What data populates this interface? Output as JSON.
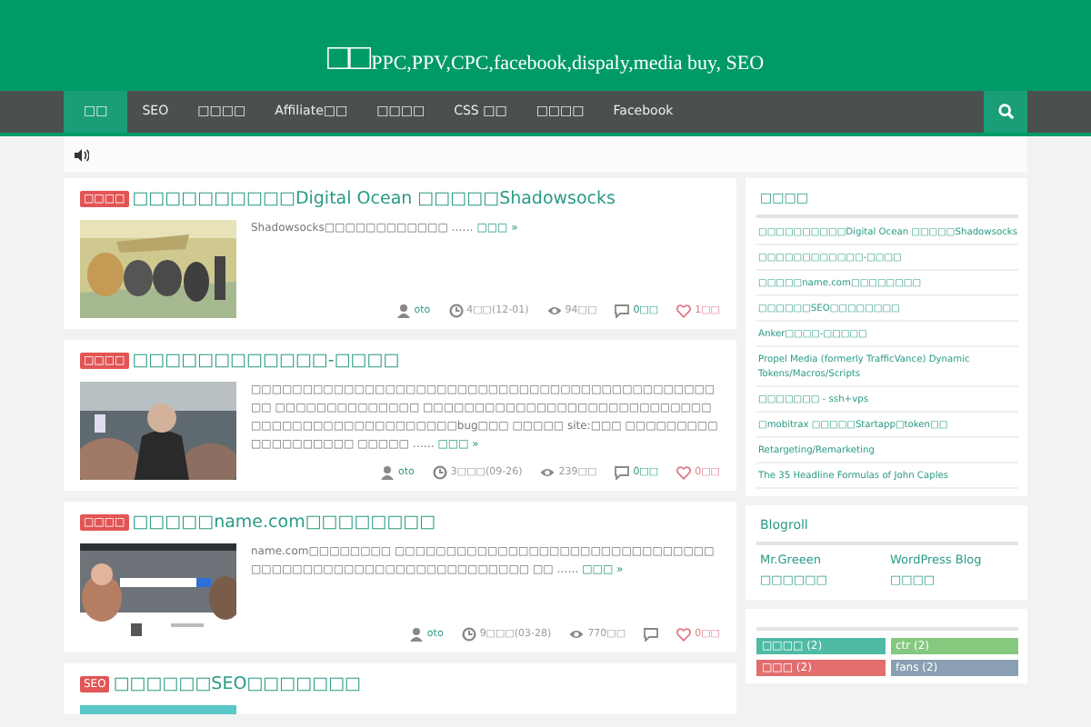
{
  "site": {
    "name": "□□",
    "tagline": "PPC,PPV,CPC,facebook,dispaly,media buy, SEO"
  },
  "nav": [
    {
      "label": "□□",
      "selected": true
    },
    {
      "label": "SEO",
      "selected": false
    },
    {
      "label": "□□□□",
      "selected": false
    },
    {
      "label": "Affiliate□□",
      "selected": false
    },
    {
      "label": "□□□□",
      "selected": false
    },
    {
      "label": "CSS □□",
      "selected": false
    },
    {
      "label": "□□□□",
      "selected": false
    },
    {
      "label": "Facebook",
      "selected": false
    }
  ],
  "posts": [
    {
      "tag": "□□□□",
      "title": "□□□□□□□□□□Digital Ocean □□□□□Shadowsocks",
      "kind": "picture",
      "excerpt": "Shadowsocks□□□□□□□□□□□□ ……",
      "more": "□□□ »",
      "author": "oto",
      "date": "4□□(12-01)",
      "views": "94□□",
      "comments": "0□□",
      "likes": "1□□"
    },
    {
      "tag": "□□□□",
      "title": "□□□□□□□□□□□□-□□□□",
      "kind": "picture",
      "excerpt": "□□□□□□□□□□□□□□□□□□□□□□□□□□□□□□□□□□□□□□□□□□□□□□□ □□□□□□□□□□□□□□ □□□□□□□□□□□□□□□□□□□□□□□□□□□□□□□□□□□□□□□□□□□□□□□□bug□□□ □□□□□ site:□□□ □□□□□□□□□□□□□□□□□□□ □□□□□ ……",
      "more": "□□□ »",
      "author": "oto",
      "date": "3□□□(09-26)",
      "views": "239□□",
      "comments": "0□□",
      "likes": "0□□"
    },
    {
      "tag": "□□□□",
      "title": "□□□□□name.com□□□□□□□□",
      "kind": "picture",
      "excerpt": "name.com□□□□□□□□ □□□□□□□□□□□□□□□□□□□□□□□□□□□□□□□□□□□□□□□□□□□□□□□□□□□□□□□□□□ □□ ……",
      "more": "□□□ »",
      "author": "oto",
      "date": "9□□□(03-28)",
      "views": "770□□",
      "likes": "0□□"
    },
    {
      "tag": "SEO",
      "title": "□□□□□□SEO□□□□□□□",
      "kind": "picture"
    }
  ],
  "recent": {
    "heading": "□□□□",
    "items": [
      "□□□□□□□□□□Digital Ocean □□□□□Shadowsocks",
      "□□□□□□□□□□□□-□□□□",
      "□□□□□name.com□□□□□□□□",
      "□□□□□□SEO□□□□□□□□",
      "Anker□□□□-□□□□□",
      "Propel Media (formerly TrafficVance) Dynamic Tokens/Macros/Scripts",
      "□□□□□□□ - ssh+vps",
      "□mobitrax □□□□□Startapp□token□□",
      "Retargeting/Remarketing",
      "The 35 Headline Formulas of John Caples"
    ]
  },
  "blogroll": {
    "heading": "Blogroll",
    "links": [
      "Mr.Greeen",
      "WordPress Blog",
      "□□□□□□",
      "□□□□"
    ]
  },
  "tags": [
    {
      "label": "□□□□ (2)",
      "color": "#4fbba4"
    },
    {
      "label": "ctr (2)",
      "color": "#85c97f"
    },
    {
      "label": "□□□ (2)",
      "color": "#e26e6e"
    },
    {
      "label": "fans (2)",
      "color": "#8a9fb3"
    }
  ]
}
